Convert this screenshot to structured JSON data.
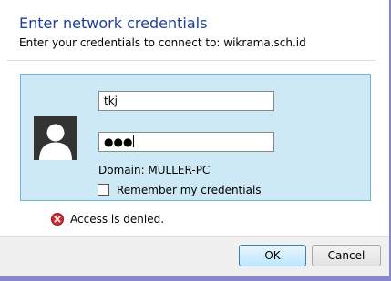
{
  "dialog": {
    "title": "Enter network credentials",
    "subtitle": "Enter your credentials to connect to: wikrama.sch.id"
  },
  "credentials": {
    "username_value": "tkj",
    "password_mask": "●●●",
    "domain_text": "Domain: MULLER-PC",
    "remember_label": "Remember my credentials",
    "remember_checked": false
  },
  "error": {
    "message": "Access is denied.",
    "icon": "error-icon"
  },
  "buttons": {
    "ok_label": "OK",
    "cancel_label": "Cancel"
  },
  "colors": {
    "title": "#1e3f9b",
    "tile_bg": "#cde9f6",
    "tile_border": "#6fb3df",
    "error_red": "#d8262b",
    "backdrop": "#8a86cc"
  },
  "icons": {
    "avatar": "user-silhouette-icon",
    "error": "error-icon"
  }
}
